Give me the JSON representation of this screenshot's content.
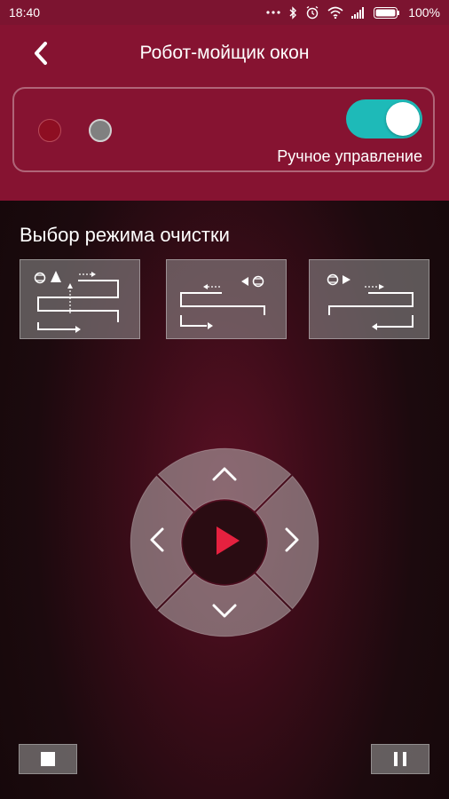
{
  "status": {
    "time": "18:40",
    "battery": "100%"
  },
  "header": {
    "title": "Робот-мойщик окон",
    "back_icon": "chevron-left-icon"
  },
  "manual": {
    "label": "Ручное управление",
    "enabled": true,
    "accent": "#1ebab8"
  },
  "indicators": {
    "red": "#8e0e22",
    "gray": "#808080"
  },
  "modes": {
    "title": "Выбор режима очистки",
    "items": [
      "mode-vertical-start",
      "mode-left-start",
      "mode-right-start"
    ]
  },
  "controls": {
    "play_color": "#e5213f",
    "up": "chevron-up-icon",
    "down": "chevron-down-icon",
    "left": "chevron-left-icon",
    "right": "chevron-right-icon"
  },
  "colors": {
    "header": "#861331",
    "statusbar": "#7c1430"
  }
}
